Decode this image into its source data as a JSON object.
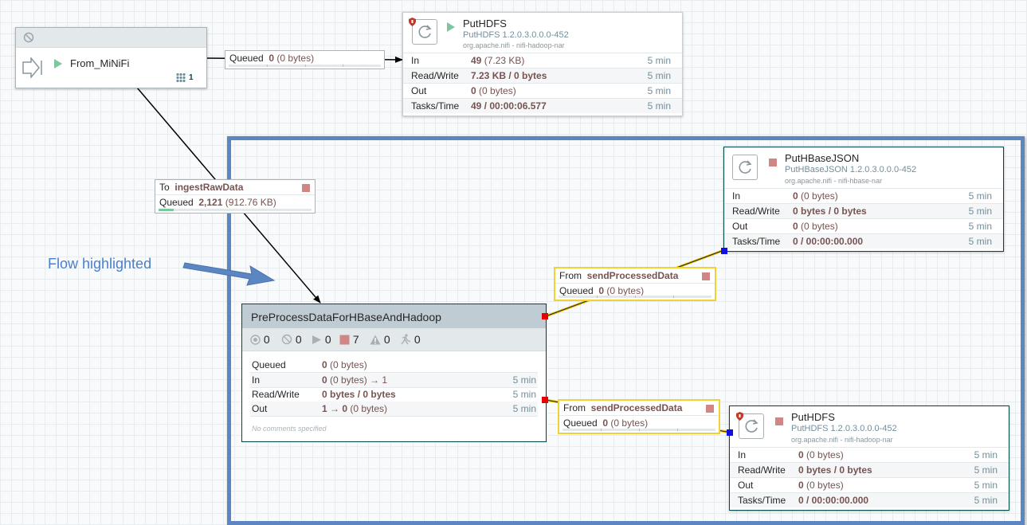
{
  "colors": {
    "selection_border": "#5b86c2",
    "annotation_text": "#4a7fcb",
    "running": "#7dc7a0",
    "stopped": "#d18686",
    "invalid_port": "#e60000",
    "dest_port": "#1010e0",
    "highlight_conn": "#f2d233"
  },
  "input_port": {
    "name": "From_MiNiFi",
    "count": "1",
    "icons": [
      "disabled-icon",
      "input-port-icon",
      "running-icon",
      "remote-ports-icon"
    ]
  },
  "conn_top": {
    "label": "Queued",
    "count": "0",
    "size": "(0 bytes)"
  },
  "puthdfs_top": {
    "name": "PutHDFS",
    "type": "PutHDFS 1.2.0.3.0.0.0-452",
    "bundle": "org.apache.nifi - nifi-hadoop-nar",
    "stats": [
      {
        "label": "In",
        "value": "49",
        "extra": "(7.23 KB)",
        "time": "5 min"
      },
      {
        "label": "Read/Write",
        "value": "7.23 KB / 0 bytes",
        "extra": "",
        "time": "5 min"
      },
      {
        "label": "Out",
        "value": "0",
        "extra": "(0 bytes)",
        "time": "5 min"
      },
      {
        "label": "Tasks/Time",
        "value": "49 / 00:00:06.577",
        "extra": "",
        "time": "5 min"
      }
    ]
  },
  "conn_ingest": {
    "to_label": "To",
    "to_name": "ingestRawData",
    "queued_label": "Queued",
    "count": "2,121",
    "size": "(912.76 KB)",
    "fill_fraction": 0.1
  },
  "annotation": {
    "text": "Flow highlighted"
  },
  "puthbase": {
    "name": "PutHBaseJSON",
    "type": "PutHBaseJSON 1.2.0.3.0.0.0-452",
    "bundle": "org.apache.nifi - nifi-hbase-nar",
    "stats": [
      {
        "label": "In",
        "value": "0",
        "extra": "(0 bytes)",
        "time": "5 min"
      },
      {
        "label": "Read/Write",
        "value": "0 bytes / 0 bytes",
        "extra": "",
        "time": "5 min"
      },
      {
        "label": "Out",
        "value": "0",
        "extra": "(0 bytes)",
        "time": "5 min"
      },
      {
        "label": "Tasks/Time",
        "value": "0 / 00:00:00.000",
        "extra": "",
        "time": "5 min"
      }
    ]
  },
  "conn_send1": {
    "from_label": "From",
    "from_name": "sendProcessedData",
    "queued_label": "Queued",
    "count": "0",
    "size": "(0 bytes)"
  },
  "conn_send2": {
    "from_label": "From",
    "from_name": "sendProcessedData",
    "queued_label": "Queued",
    "count": "0",
    "size": "(0 bytes)"
  },
  "process_group": {
    "name": "PreProcessDataForHBaseAndHadoop",
    "status": {
      "transmitting": "0",
      "not_transmitting": "0",
      "running": "0",
      "stopped": "7",
      "invalid": "0",
      "disabled": "0"
    },
    "rows": [
      {
        "label": "Queued",
        "value": "0",
        "extra": "(0 bytes)",
        "time": ""
      },
      {
        "label": "In",
        "value": "0",
        "extra": "(0 bytes) → 1",
        "time": "5 min"
      },
      {
        "label": "Read/Write",
        "value": "0 bytes / 0 bytes",
        "extra": "",
        "time": "5 min"
      },
      {
        "label": "Out",
        "value": "1 → 0",
        "extra": "(0 bytes)",
        "time": "5 min"
      }
    ],
    "comments": "No comments specified"
  },
  "puthdfs_bottom": {
    "name": "PutHDFS",
    "type": "PutHDFS 1.2.0.3.0.0.0-452",
    "bundle": "org.apache.nifi - nifi-hadoop-nar",
    "stats": [
      {
        "label": "In",
        "value": "0",
        "extra": "(0 bytes)",
        "time": "5 min"
      },
      {
        "label": "Read/Write",
        "value": "0 bytes / 0 bytes",
        "extra": "",
        "time": "5 min"
      },
      {
        "label": "Out",
        "value": "0",
        "extra": "(0 bytes)",
        "time": "5 min"
      },
      {
        "label": "Tasks/Time",
        "value": "0 / 00:00:00.000",
        "extra": "",
        "time": "5 min"
      }
    ]
  }
}
